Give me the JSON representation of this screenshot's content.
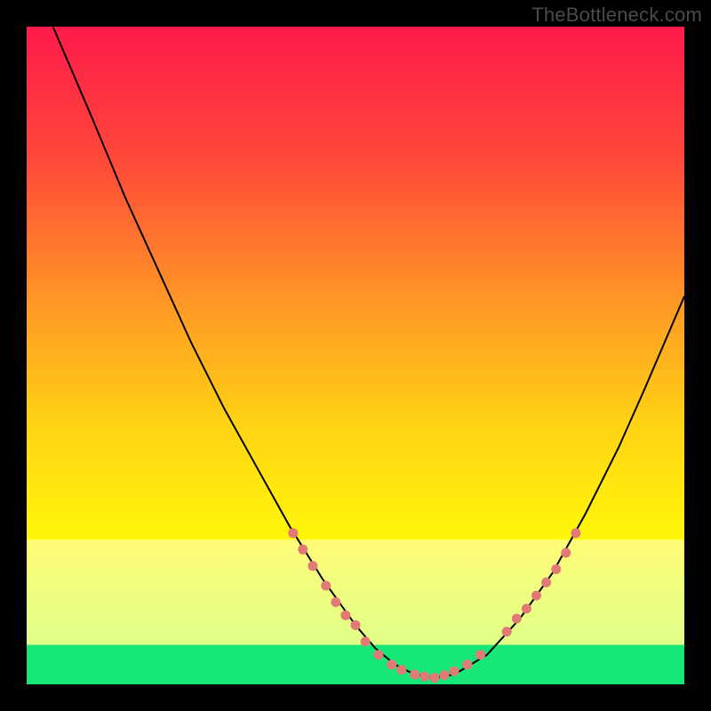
{
  "watermark": "TheBottleneck.com",
  "chart_data": {
    "type": "line",
    "title": "",
    "xlabel": "",
    "ylabel": "",
    "xlim": [
      0,
      100
    ],
    "ylim": [
      0,
      100
    ],
    "grid": false,
    "legend": false,
    "background_gradient": {
      "stops": [
        {
          "offset": 0.0,
          "color": "#ff1a4b"
        },
        {
          "offset": 0.2,
          "color": "#ff4839"
        },
        {
          "offset": 0.4,
          "color": "#ff9127"
        },
        {
          "offset": 0.6,
          "color": "#ffd215"
        },
        {
          "offset": 0.78,
          "color": "#fff70a"
        },
        {
          "offset": 0.94,
          "color": "#b9ff2e"
        },
        {
          "offset": 1.0,
          "color": "#00e06a"
        }
      ]
    },
    "green_band": {
      "y_from": 94,
      "y_to": 100
    },
    "pale_band": {
      "y_from": 78,
      "y_to": 94
    },
    "series": [
      {
        "name": "bottleneck-curve",
        "type": "line",
        "color": "#000000",
        "x": [
          4,
          10,
          15,
          20,
          25,
          30,
          35,
          40,
          45,
          50,
          53,
          56,
          59,
          62,
          65,
          70,
          75,
          80,
          85,
          90,
          94,
          97,
          100
        ],
        "y": [
          0,
          14,
          26,
          37,
          48,
          58,
          67,
          76,
          84,
          91,
          94.5,
          97,
          98.5,
          99,
          98.5,
          95.5,
          90,
          83,
          74,
          64,
          55,
          48,
          41
        ]
      },
      {
        "name": "highlight-dots-left",
        "type": "scatter",
        "color": "#e17a77",
        "x": [
          40.5,
          42.0,
          43.5,
          45.5,
          47.0,
          48.5,
          50.0,
          51.5
        ],
        "y": [
          77.0,
          79.5,
          82.0,
          85.0,
          87.5,
          89.5,
          91.0,
          93.5
        ]
      },
      {
        "name": "highlight-dots-bottom",
        "type": "scatter",
        "color": "#e17a77",
        "x": [
          53.5,
          55.5,
          57.0,
          59.0,
          60.5,
          62.0,
          63.5,
          65.0,
          67.0,
          69.0
        ],
        "y": [
          95.5,
          97.0,
          97.8,
          98.5,
          98.8,
          99.0,
          98.6,
          98.0,
          97.0,
          95.5
        ]
      },
      {
        "name": "highlight-dots-right",
        "type": "scatter",
        "color": "#e17a77",
        "x": [
          73.0,
          74.5,
          76.0,
          77.5,
          79.0,
          80.5,
          82.0,
          83.5
        ],
        "y": [
          92.0,
          90.0,
          88.5,
          86.5,
          84.5,
          82.5,
          80.0,
          77.0
        ]
      }
    ]
  }
}
